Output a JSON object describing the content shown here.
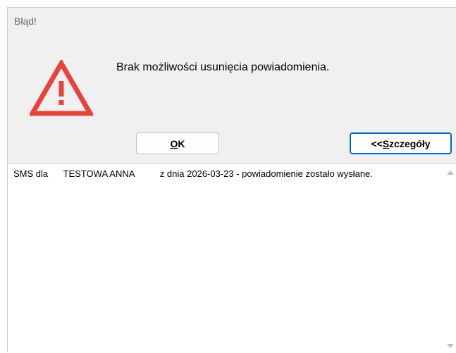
{
  "dialog": {
    "title": "Błąd!",
    "icon": "warning-triangle-icon",
    "message": "Brak możliwości usunięcia powiadomienia.",
    "accent_color": "#e8433a"
  },
  "buttons": {
    "ok_prefix": "",
    "ok_mnemonic": "O",
    "ok_rest": "K",
    "details_prefix": "<<",
    "details_mnemonic": "S",
    "details_rest": "zczegóły"
  },
  "details": {
    "text": "SMS dla      TESTOWA ANNA          z dnia 2026-03-23 - powiadomienie zostało wysłane."
  },
  "scrollbar": {
    "up_icon": "scroll-up-arrow-icon",
    "down_icon": "scroll-down-arrow-icon"
  }
}
